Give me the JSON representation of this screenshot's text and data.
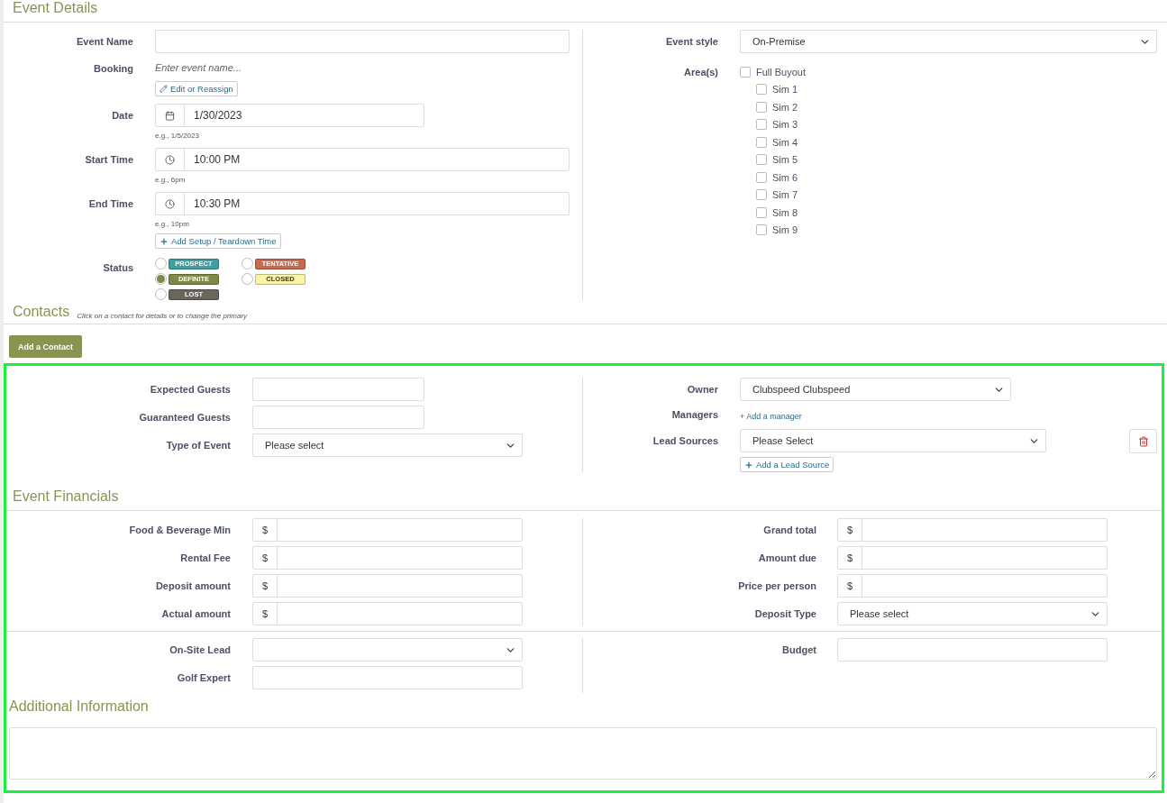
{
  "event_details": {
    "title": "Event Details",
    "event_name": {
      "label": "Event Name"
    },
    "booking": {
      "label": "Booking",
      "text": "Enter event name...",
      "button": "Edit or Reassign"
    },
    "date": {
      "label": "Date",
      "value": "1/30/2023",
      "hint": "e.g., 1/5/2023"
    },
    "start_time": {
      "label": "Start Time",
      "value": "10:00 PM",
      "hint": "e.g., 6pm"
    },
    "end_time": {
      "label": "End Time",
      "value": "10:30 PM",
      "hint": "e.g., 10pm"
    },
    "setup_button": "Add Setup / Teardown Time",
    "status": {
      "label": "Status",
      "options": [
        {
          "label": "PROSPECT",
          "color": "#3e9ea0",
          "selected": false
        },
        {
          "label": "TENTATIVE",
          "color": "#c8694e",
          "selected": false
        },
        {
          "label": "DEFINITE",
          "color": "#7c8a45",
          "selected": true
        },
        {
          "label": "CLOSED",
          "color": "#fbf3a6",
          "selected": false
        },
        {
          "label": "LOST",
          "color": "#6b645d",
          "selected": false
        }
      ]
    },
    "event_style": {
      "label": "Event style",
      "value": "On-Premise"
    },
    "areas": {
      "label": "Area(s)",
      "items": [
        {
          "label": "Full Buyout",
          "checked": false,
          "children": [
            {
              "label": "Sim 1",
              "checked": false
            },
            {
              "label": "Sim 2",
              "checked": false
            },
            {
              "label": "Sim 3",
              "checked": false
            },
            {
              "label": "Sim 4",
              "checked": false
            },
            {
              "label": "Sim 5",
              "checked": false
            },
            {
              "label": "Sim 6",
              "checked": false
            },
            {
              "label": "Sim 7",
              "checked": false
            },
            {
              "label": "Sim 8",
              "checked": false
            },
            {
              "label": "Sim 9",
              "checked": false
            }
          ]
        }
      ]
    }
  },
  "contacts": {
    "title": "Contacts",
    "hint": "Click on a contact for details or to change the primary",
    "button": "Add a Contact"
  },
  "event_info": {
    "expected_guests": {
      "label": "Expected Guests"
    },
    "guaranteed_guests": {
      "label": "Guaranteed Guests"
    },
    "type_of_event": {
      "label": "Type of Event",
      "value": "Please select"
    },
    "owner": {
      "label": "Owner",
      "value": "Clubspeed Clubspeed"
    },
    "managers": {
      "label": "Managers",
      "link": "+ Add a manager"
    },
    "lead_sources": {
      "label": "Lead Sources",
      "value": "Please Select",
      "add_button": "Add a Lead Source"
    }
  },
  "financials": {
    "title": "Event Financials",
    "left": [
      {
        "label": "Food & Beverage Min",
        "kind": "currency",
        "prefix": "$"
      },
      {
        "label": "Rental Fee",
        "kind": "currency",
        "prefix": "$"
      },
      {
        "label": "Deposit amount",
        "kind": "currency",
        "prefix": "$"
      },
      {
        "label": "Actual amount",
        "kind": "currency",
        "prefix": "$"
      }
    ],
    "right": [
      {
        "label": "Grand total",
        "kind": "currency",
        "prefix": "$"
      },
      {
        "label": "Amount due",
        "kind": "currency",
        "prefix": "$"
      },
      {
        "label": "Price per person",
        "kind": "currency",
        "prefix": "$"
      },
      {
        "label": "Deposit Type",
        "kind": "select",
        "value": "Please select"
      }
    ],
    "left_extra": [
      {
        "label": "On-Site Lead",
        "kind": "select"
      },
      {
        "label": "Golf Expert",
        "kind": "text"
      }
    ],
    "right_extra": [
      {
        "label": "Budget",
        "kind": "text"
      }
    ]
  },
  "additional_information": {
    "title": "Additional Information"
  }
}
